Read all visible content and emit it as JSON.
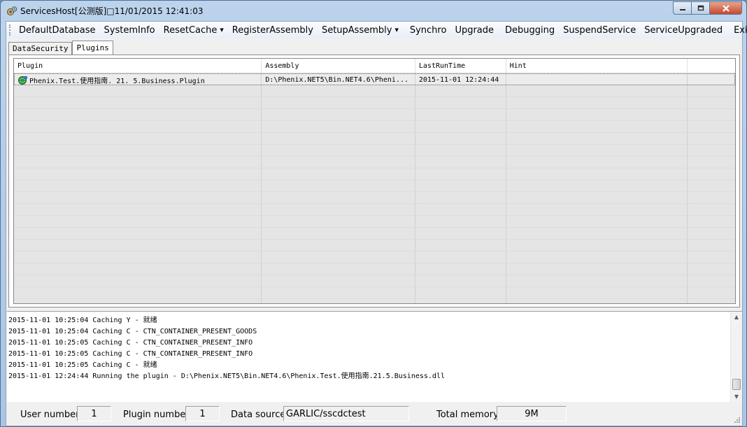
{
  "window": {
    "title": "ServicesHost[公测版]□11/01/2015 12:41:03",
    "icon": "gears-icon"
  },
  "menu": {
    "items": [
      {
        "label": "DefaultDatabase"
      },
      {
        "label": "SystemInfo"
      },
      {
        "label": "ResetCache",
        "dropdown": true
      },
      {
        "label": "RegisterAssembly"
      },
      {
        "label": "SetupAssembly",
        "dropdown": true
      },
      {
        "label": "Synchro"
      },
      {
        "label": "Upgrade"
      },
      {
        "label": "Debugging"
      },
      {
        "label": "SuspendService"
      },
      {
        "label": "ServiceUpgraded"
      },
      {
        "label": "Exit"
      }
    ]
  },
  "tabs": [
    {
      "label": "DataSecurity",
      "active": false
    },
    {
      "label": "Plugins",
      "active": true
    }
  ],
  "grid": {
    "columns": [
      "Plugin",
      "Assembly",
      "LastRunTime",
      "Hint"
    ],
    "rows": [
      {
        "plugin": "Phenix.Test.使用指南._21._5.Business.Plugin",
        "assembly": "D:\\Phenix.NET5\\Bin.NET4.6\\Pheni...",
        "last_run": "2015-11-01 12:24:44",
        "hint": ""
      }
    ]
  },
  "log": {
    "lines": [
      "2015-11-01 10:25:04 Caching Y  - 就绪",
      "2015-11-01 10:25:04 Caching C  - CTN_CONTAINER_PRESENT_GOODS",
      "2015-11-01 10:25:05 Caching C  - CTN_CONTAINER_PRESENT_INFO",
      "2015-11-01 10:25:05 Caching C  - CTN_CONTAINER_PRESENT_INFO",
      "2015-11-01 10:25:05 Caching C  - 就绪",
      "2015-11-01 12:24:44 Running the plugin - D:\\Phenix.NET5\\Bin.NET4.6\\Phenix.Test.使用指南.21.5.Business.dll"
    ]
  },
  "status": {
    "user_number_label": "User number",
    "user_number": "1",
    "plugin_number_label": "Plugin number",
    "plugin_number": "1",
    "data_source_label": "Data source",
    "data_source": "GARLIC/sscdctest",
    "total_memory_label": "Total memory",
    "total_memory": "9M"
  }
}
